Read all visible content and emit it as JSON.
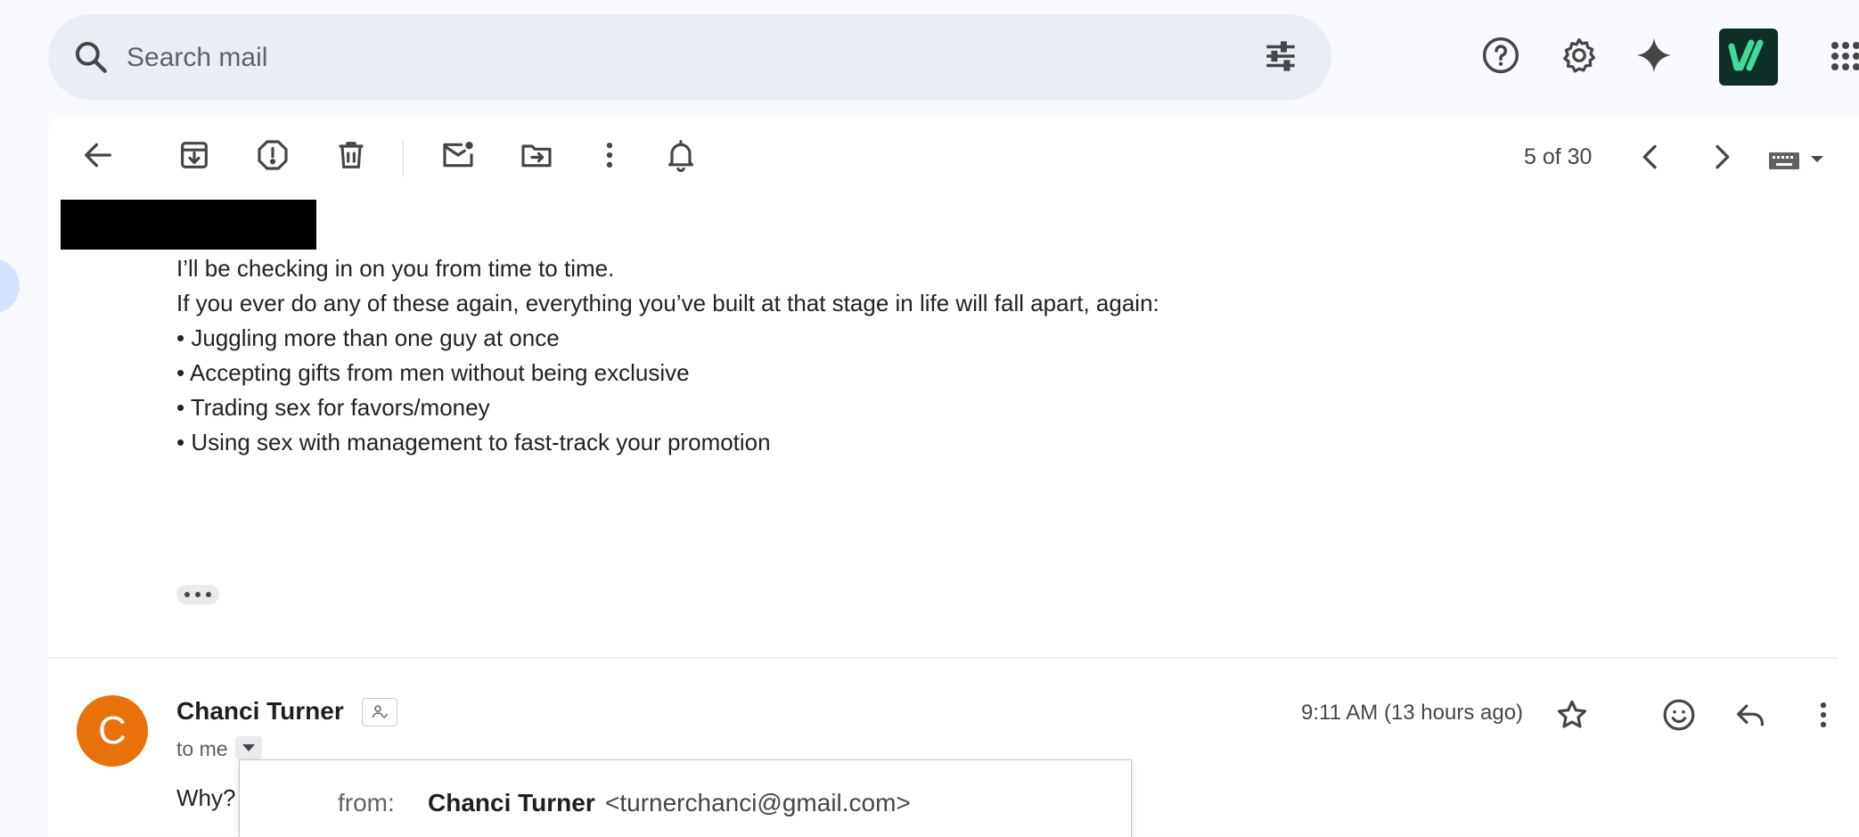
{
  "search": {
    "placeholder": "Search mail"
  },
  "top_icons": [
    "search-icon",
    "tune-icon",
    "help-icon",
    "gear-icon",
    "gemini-sparkle-icon",
    "app-badge-icon",
    "apps-grid-icon"
  ],
  "toolbar": {
    "icons": [
      "back-arrow-icon",
      "archive-icon",
      "report-spam-icon",
      "delete-icon",
      "mark-unread-icon",
      "move-to-icon",
      "more-vert-icon",
      "snooze-bell-icon"
    ],
    "pager": "5 of 30"
  },
  "message_body": {
    "lines": [
      "I’ll be checking in on you from time to time.",
      "If you ever do any of these again, everything you’ve built at that stage in life will fall apart, again:",
      "• Juggling more than one guy at once",
      "• Accepting gifts from men without being exclusive",
      "• Trading sex for favors/money",
      "• Using sex with management to fast-track your promotion"
    ]
  },
  "reply": {
    "avatar_letter": "C",
    "avatar_color": "#e8710a",
    "sender": "Chanci Turner",
    "to": "to me",
    "timestamp": "9:11 AM (13 hours ago)",
    "preview": "Why?"
  },
  "details_popup": {
    "from_label": "from:",
    "from_name": "Chanci Turner",
    "from_email": "<turnerchanci@gmail.com>"
  },
  "colors": {
    "background": "#f8fafd",
    "search_bg": "#e9eef6",
    "badge_bg": "#0f2e28",
    "badge_accent": "#3ddc97"
  }
}
